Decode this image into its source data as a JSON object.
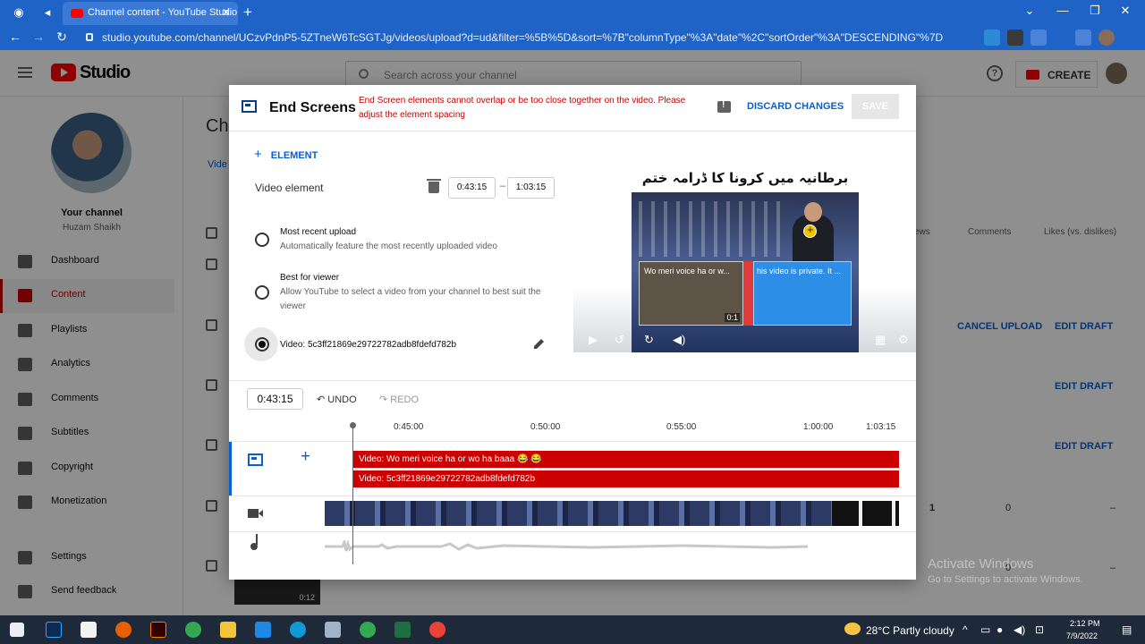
{
  "browser": {
    "tab_title": "Channel content - YouTube Studio",
    "url": "studio.youtube.com/channel/UCzvPdnP5-5ZTneW6TcSGTJg/videos/upload?d=ud&filter=%5B%5D&sort=%7B\"columnType\"%3A\"date\"%2C\"sortOrder\"%3A\"DESCENDING\"%7D"
  },
  "header": {
    "logo_text": "Studio",
    "search_placeholder": "Search across your channel",
    "create_label": "CREATE"
  },
  "sidebar": {
    "your_channel": "Your channel",
    "channel_name": "Huzam Shaikh",
    "items": [
      {
        "label": "Dashboard"
      },
      {
        "label": "Content"
      },
      {
        "label": "Playlists"
      },
      {
        "label": "Analytics"
      },
      {
        "label": "Comments"
      },
      {
        "label": "Subtitles"
      },
      {
        "label": "Copyright"
      },
      {
        "label": "Monetization"
      },
      {
        "label": "Settings"
      },
      {
        "label": "Send feedback"
      }
    ]
  },
  "background": {
    "page_title_fragment": "Cha",
    "tab_fragment": "Vide",
    "col_views_fragment": "ews",
    "col_comments": "Comments",
    "col_likes": "Likes (vs. dislikes)",
    "cancel_upload": "CANCEL UPLOAD",
    "edit_draft": "EDIT DRAFT",
    "row_views": "1",
    "row_comments": "0",
    "row_likes": "–",
    "thumb_duration": "0:12"
  },
  "modal": {
    "title": "End Screens",
    "error": "End Screen elements cannot overlap or be too close together on the video. Please adjust the element spacing",
    "discard_label": "DISCARD CHANGES",
    "save_label": "SAVE",
    "add_element_label": "ELEMENT",
    "video_element_label": "Video element",
    "start_time": "0:43:15",
    "end_time": "1:03:15",
    "options": [
      {
        "title": "Most recent upload",
        "desc": "Automatically feature the most recently uploaded video"
      },
      {
        "title": "Best for viewer",
        "desc": "Allow YouTube to select a video from your channel to best suit the viewer"
      },
      {
        "title": "Video: 5c3ff21869e29722782adb8fdefd782b",
        "desc": ""
      }
    ],
    "selected_option": 2,
    "preview": {
      "urdu_title": "برطانیہ میں کرونا کا ڈرامہ ختم",
      "element_a_label": "Wo meri voice ha or w...",
      "element_a_duration": "0:1",
      "element_b_label": "his video is private. It ..."
    },
    "timeline": {
      "current_time": "0:43:15",
      "undo_label": "UNDO",
      "redo_label": "REDO",
      "ticks": [
        "0:45:00",
        "0:50:00",
        "0:55:00",
        "1:00:00",
        "1:03:15"
      ],
      "tracks": [
        "Video: Wo meri voice ha or wo ha baaa 😂 😂",
        "Video: 5c3ff21869e29722782adb8fdefd782b"
      ]
    }
  },
  "watermark": {
    "line1": "Activate Windows",
    "line2": "Go to Settings to activate Windows."
  },
  "taskbar": {
    "weather": "28°C  Partly cloudy",
    "time": "2:12 PM",
    "date": "7/9/2022"
  },
  "colors": {
    "accent_blue": "#065fd4",
    "error_red": "#cc0000",
    "browser_blue": "#1f63c6"
  }
}
